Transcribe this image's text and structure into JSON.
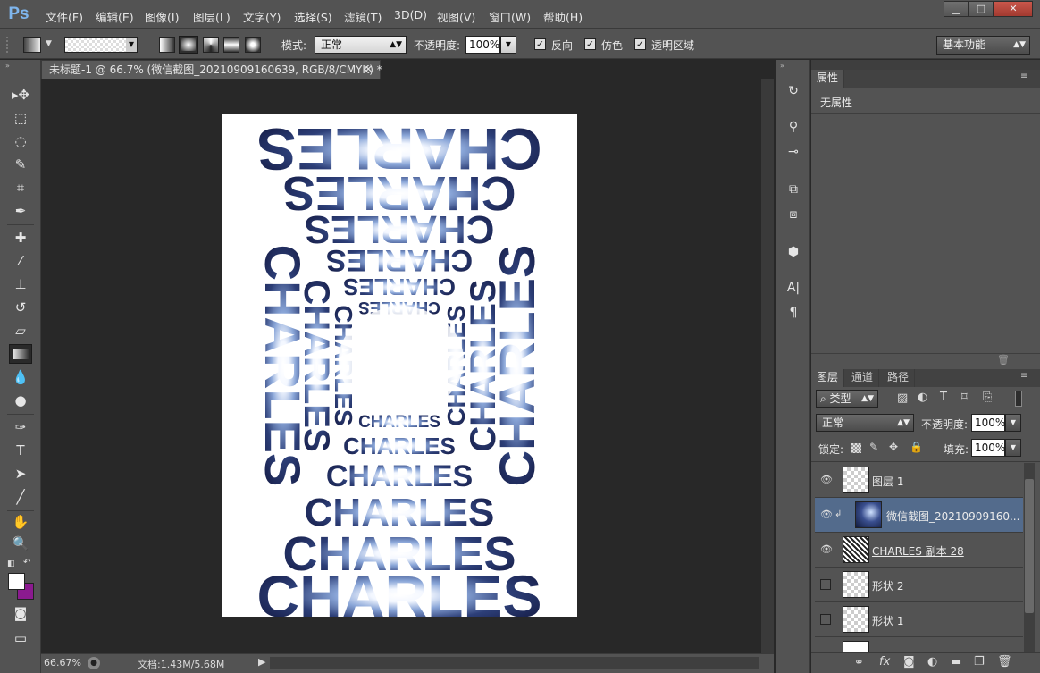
{
  "app": {
    "logo": "Ps"
  },
  "menu": [
    "文件(F)",
    "编辑(E)",
    "图像(I)",
    "图层(L)",
    "文字(Y)",
    "选择(S)",
    "滤镜(T)",
    "3D(D)",
    "视图(V)",
    "窗口(W)",
    "帮助(H)"
  ],
  "window_controls": {
    "minimize": "▁",
    "maximize": "□",
    "close": "✕"
  },
  "options": {
    "mode_label": "模式:",
    "mode_value": "正常",
    "opacity_label": "不透明度:",
    "opacity_value": "100%",
    "reverse_label": "反向",
    "dither_label": "仿色",
    "transparency_label": "透明区域",
    "workspace": "基本功能"
  },
  "document": {
    "tab_title": "未标题-1 @ 66.7% (微信截图_20210909160639, RGB/8/CMYK) *",
    "canvas_text": "CHARLES",
    "zoom": "66.67%",
    "doc_size": "文档:1.43M/5.68M"
  },
  "properties": {
    "tab": "属性",
    "content": "无属性"
  },
  "layers_panel": {
    "tabs": [
      "图层",
      "通道",
      "路径"
    ],
    "filter_label": "类型",
    "blend_mode": "正常",
    "opacity_label": "不透明度:",
    "opacity_value": "100%",
    "lock_label": "锁定:",
    "fill_label": "填充:",
    "fill_value": "100%",
    "layers": [
      {
        "name": "图层 1",
        "visible": true
      },
      {
        "name": "微信截图_20210909160...",
        "visible": true
      },
      {
        "name": "CHARLES 副本 28",
        "visible": true
      },
      {
        "name": "形状 2",
        "visible": false
      },
      {
        "name": "形状 1",
        "visible": false
      }
    ]
  },
  "colors": {
    "foreground": "#ffffff",
    "background": "#8b1a8f"
  }
}
